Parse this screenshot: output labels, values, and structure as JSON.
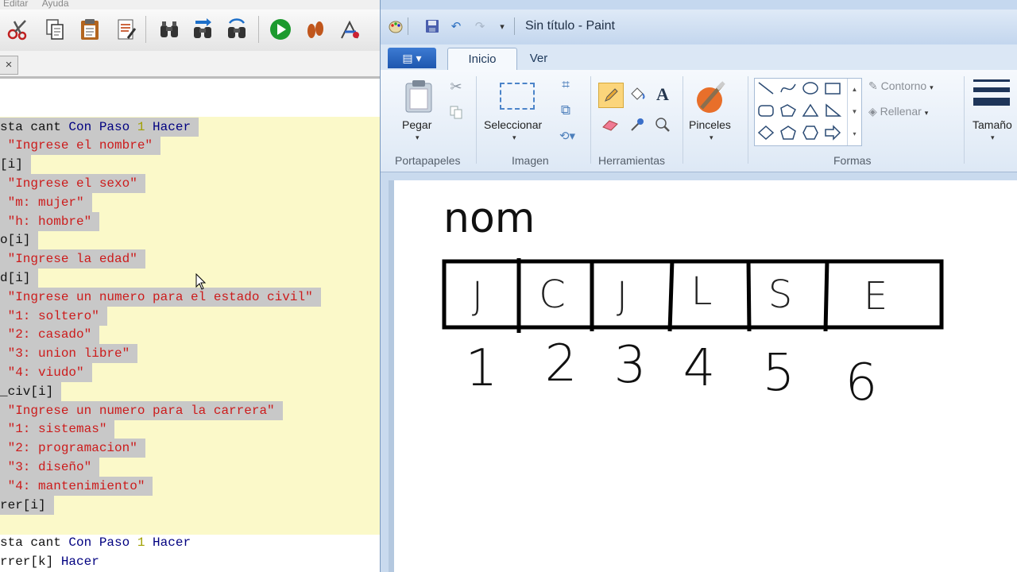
{
  "editor": {
    "menu": [
      "Editar",
      "Ayuda"
    ],
    "toolbar_icons": [
      "cut-icon",
      "copy-icon",
      "paste-icon",
      "edit-icon",
      "find-icon",
      "find-next-icon",
      "replace-icon",
      "run-icon",
      "step-icon",
      "debug-icon"
    ],
    "tab_close": "×",
    "code_lines": [
      {
        "parts": [
          [
            "var",
            "sta cant "
          ],
          [
            "kw",
            "Con Paso "
          ],
          [
            "num",
            "1"
          ],
          [
            "kw",
            " Hacer"
          ]
        ],
        "sel": true
      },
      {
        "parts": [
          [
            "str",
            " \"Ingrese el nombre\""
          ]
        ],
        "sel": true
      },
      {
        "parts": [
          [
            "var",
            "[i]"
          ]
        ],
        "sel": true
      },
      {
        "parts": [
          [
            "str",
            " \"Ingrese el sexo\""
          ]
        ],
        "sel": true
      },
      {
        "parts": [
          [
            "str",
            " \"m: mujer\""
          ]
        ],
        "sel": true
      },
      {
        "parts": [
          [
            "str",
            " \"h: hombre\""
          ]
        ],
        "sel": true
      },
      {
        "parts": [
          [
            "var",
            "o[i]"
          ]
        ],
        "sel": true
      },
      {
        "parts": [
          [
            "str",
            " \"Ingrese la edad\""
          ]
        ],
        "sel": true
      },
      {
        "parts": [
          [
            "var",
            "d[i]"
          ]
        ],
        "sel": true
      },
      {
        "parts": [
          [
            "str",
            " \"Ingrese un numero para el estado civil\""
          ]
        ],
        "sel": true
      },
      {
        "parts": [
          [
            "str",
            " \"1: soltero\""
          ]
        ],
        "sel": true
      },
      {
        "parts": [
          [
            "str",
            " \"2: casado\""
          ]
        ],
        "sel": true
      },
      {
        "parts": [
          [
            "str",
            " \"3: union libre\""
          ]
        ],
        "sel": true
      },
      {
        "parts": [
          [
            "str",
            " \"4: viudo\""
          ]
        ],
        "sel": true
      },
      {
        "parts": [
          [
            "var",
            "_civ[i]"
          ]
        ],
        "sel": true
      },
      {
        "parts": [
          [
            "str",
            " \"Ingrese un numero para la carrera\""
          ]
        ],
        "sel": true
      },
      {
        "parts": [
          [
            "str",
            " \"1: sistemas\""
          ]
        ],
        "sel": true
      },
      {
        "parts": [
          [
            "str",
            " \"2: programacion\""
          ]
        ],
        "sel": true
      },
      {
        "parts": [
          [
            "str",
            " \"3: diseño\""
          ]
        ],
        "sel": true
      },
      {
        "parts": [
          [
            "str",
            " \"4: mantenimiento\""
          ]
        ],
        "sel": true
      },
      {
        "parts": [
          [
            "var",
            "rer[i]"
          ]
        ],
        "sel": true
      },
      {
        "parts": [
          [
            "var",
            ""
          ]
        ],
        "sel": false
      },
      {
        "parts": [
          [
            "var",
            "sta cant "
          ],
          [
            "kw",
            "Con Paso "
          ],
          [
            "num",
            "1"
          ],
          [
            "kw",
            " Hacer"
          ]
        ],
        "sel": false
      },
      {
        "parts": [
          [
            "var",
            "rrer[k] "
          ],
          [
            "kw",
            "Hacer"
          ]
        ],
        "sel": false
      }
    ]
  },
  "paint": {
    "title": "Sin título - Paint",
    "file_menu_icon": "menu-icon",
    "tabs": [
      "Inicio",
      "Ver"
    ],
    "groups": {
      "clipboard": {
        "label": "Portapapeles",
        "paste": "Pegar"
      },
      "image": {
        "label": "Imagen",
        "select": "Seleccionar"
      },
      "tools": {
        "label": "Herramientas"
      },
      "brushes": {
        "label": "Pinceles"
      },
      "shapes": {
        "label": "Formas",
        "outline": "Contorno",
        "fill": "Rellenar"
      },
      "size": {
        "label": "Tamaño"
      }
    },
    "canvas": {
      "word": "nom",
      "boxes": [
        "J",
        "C",
        "J",
        "L",
        "S",
        "E"
      ],
      "indices": [
        "1",
        "2",
        "3",
        "4",
        "5",
        "6"
      ]
    }
  }
}
